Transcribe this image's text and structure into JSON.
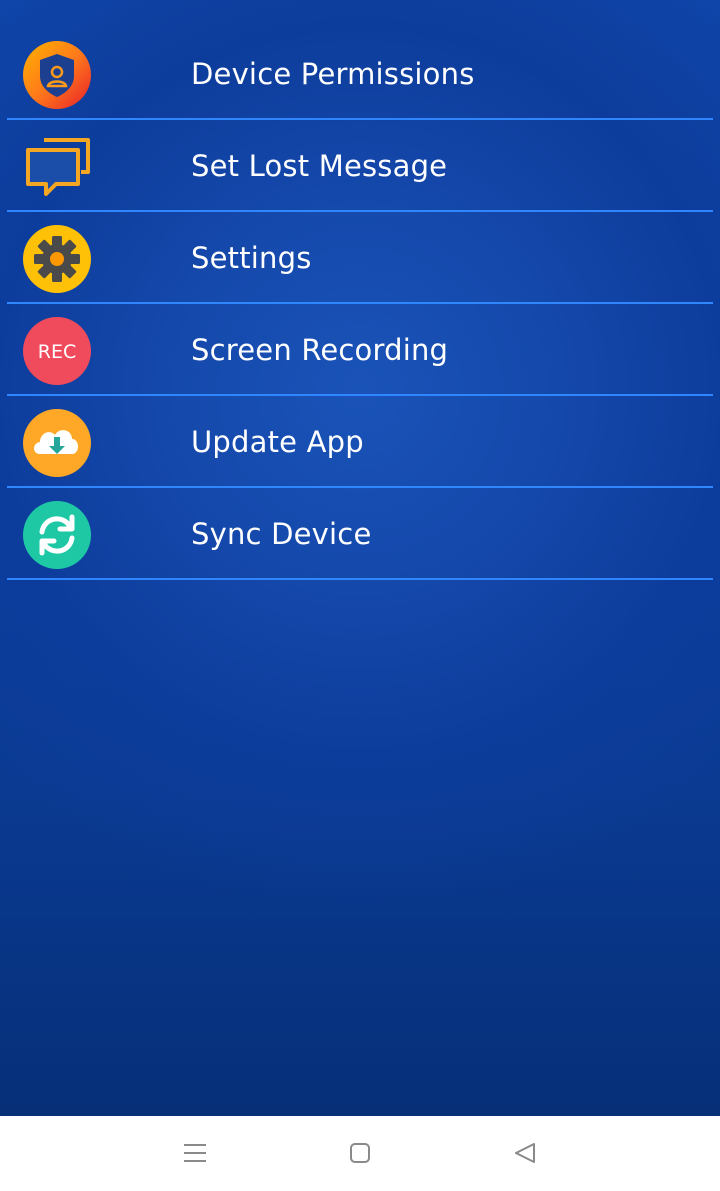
{
  "menu": {
    "items": [
      {
        "label": "Device Permissions",
        "icon": "shield-person-icon"
      },
      {
        "label": "Set Lost Message",
        "icon": "chat-bubbles-icon"
      },
      {
        "label": "Settings",
        "icon": "gear-icon"
      },
      {
        "label": "Screen Recording",
        "icon": "rec-icon",
        "icon_text": "REC"
      },
      {
        "label": "Update App",
        "icon": "cloud-download-icon"
      },
      {
        "label": "Sync Device",
        "icon": "sync-icon"
      }
    ]
  },
  "navigation": {
    "buttons": [
      "menu-icon",
      "home-icon",
      "back-icon"
    ]
  },
  "colors": {
    "background": "#0f44a8",
    "divider": "#2f86ff",
    "text": "#ffffff",
    "nav_background": "#ffffff"
  }
}
